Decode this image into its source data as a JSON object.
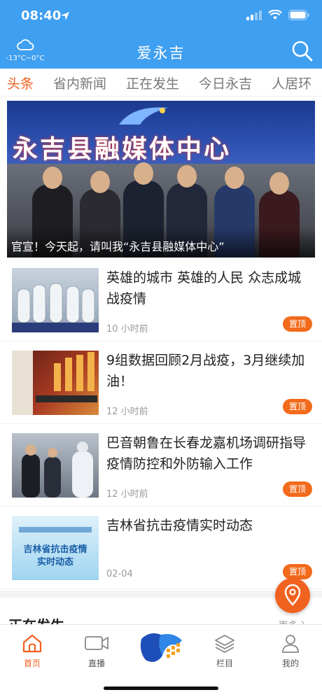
{
  "status_bar": {
    "time": "08:40"
  },
  "header": {
    "weather_temp": "-13°C~0°C",
    "title": "爱永吉"
  },
  "tabs": [
    {
      "label": "头条",
      "active": true
    },
    {
      "label": "省内新闻",
      "active": false
    },
    {
      "label": "正在发生",
      "active": false
    },
    {
      "label": "今日永吉",
      "active": false
    },
    {
      "label": "人居环",
      "active": false
    }
  ],
  "hero": {
    "banner_text": "永吉县融媒体中心",
    "caption": "官宣！今天起，请叫我“永吉县融媒体中心”"
  },
  "news": [
    {
      "title": "英雄的城市 英雄的人民 众志成城战疫情",
      "time": "10 小时前",
      "badge": "置顶"
    },
    {
      "title": "9组数据回顾2月战疫，3月继续加油！",
      "time": "12 小时前",
      "badge": "置顶"
    },
    {
      "title": "巴音朝鲁在长春龙嘉机场调研指导疫情防控和外防输入工作",
      "time": "12 小时前",
      "badge": "置顶"
    },
    {
      "title": "吉林省抗击疫情实时动态",
      "time": "02-04",
      "badge": "置顶"
    }
  ],
  "thumb4": {
    "line1": "吉林省抗击疫情",
    "line2": "实时动态"
  },
  "section": {
    "title": "正在发生",
    "more": "更多 〉"
  },
  "bottom_nav": [
    {
      "label": "首页",
      "active": true
    },
    {
      "label": "直播",
      "active": false
    },
    {
      "label": "栏目",
      "active": false
    },
    {
      "label": "我的",
      "active": false
    }
  ],
  "colors": {
    "header_blue": "#3f9ff0",
    "accent_orange": "#f25f1e"
  }
}
